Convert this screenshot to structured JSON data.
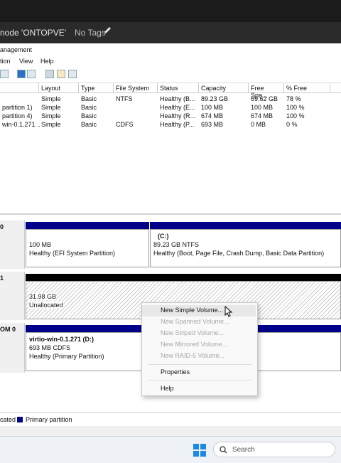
{
  "pve": {
    "title": "node 'ONTOPVE'",
    "tags": "No Tags"
  },
  "app": {
    "title": "anagement"
  },
  "menu": [
    "tion",
    "View",
    "Help"
  ],
  "table": {
    "headers": [
      "Layout",
      "Type",
      "File System",
      "Status",
      "Capacity",
      "Free Spa...",
      "% Free"
    ],
    "rows": [
      {
        "volume": "",
        "layout": "Simple",
        "type": "Basic",
        "fs": "NTFS",
        "status": "Healthy (B...",
        "capacity": "89.23 GB",
        "free": "69.62 GB",
        "pct": "78 %"
      },
      {
        "volume": "partition 1)",
        "layout": "Simple",
        "type": "Basic",
        "fs": "",
        "status": "Healthy (E...",
        "capacity": "100 MB",
        "free": "100 MB",
        "pct": "100 %"
      },
      {
        "volume": "partition 4)",
        "layout": "Simple",
        "type": "Basic",
        "fs": "",
        "status": "Healthy (R...",
        "capacity": "674 MB",
        "free": "674 MB",
        "pct": "100 %"
      },
      {
        "volume": "win-0.1.271 ...",
        "layout": "Simple",
        "type": "Basic",
        "fs": "CDFS",
        "status": "Healthy (P...",
        "capacity": "693 MB",
        "free": "0 MB",
        "pct": "0 %"
      }
    ]
  },
  "disks": {
    "disk0": {
      "label": "0",
      "p1": {
        "size": "100 MB",
        "status": "Healthy (EFI System Partition)"
      },
      "p2": {
        "name": "(C:)",
        "size": "89.23 GB NTFS",
        "status": "Healthy (Boot, Page File, Crash Dump, Basic Data Partition)"
      }
    },
    "disk1": {
      "label": "1",
      "size": "31.98 GB",
      "status": "Unallocated"
    },
    "cdrom": {
      "label": "OM 0",
      "name": "virtio-win-0.1.271  (D:)",
      "size": "693 MB CDFS",
      "status": "Healthy (Primary Partition)"
    }
  },
  "legend": {
    "unallocated": "cated",
    "primary": "Primary partition"
  },
  "context_menu": {
    "items": [
      "New Simple Volume...",
      "New Spanned Volume...",
      "New Striped Volume...",
      "New Mirrored Volume...",
      "New RAID-5 Volume...",
      "Properties",
      "Help"
    ]
  },
  "taskbar": {
    "search_placeholder": "Search"
  },
  "colors": {
    "primary_partition": "#00008b",
    "unallocated": "#000000"
  }
}
